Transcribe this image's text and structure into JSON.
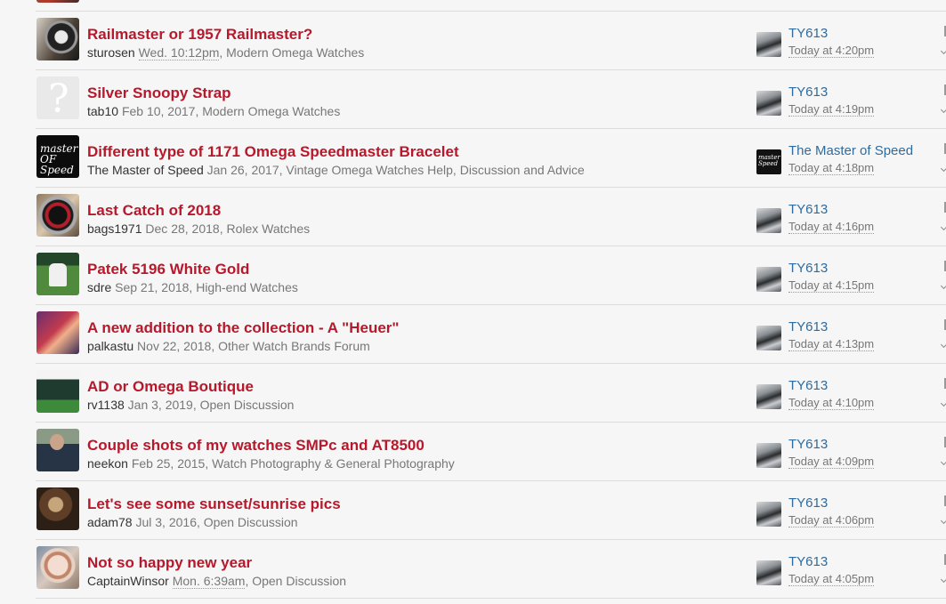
{
  "threads": [
    {
      "title": "Railmaster or 1957 Railmaster?",
      "author": "sturosen",
      "date": "Wed. 10:12pm",
      "forum": "Modern Omega Watches",
      "last_user": "TY613",
      "last_date": "Today at 4:20pm",
      "avatar": "watch-avatar"
    },
    {
      "title": "Silver Snoopy Strap",
      "author": "tab10",
      "date": "Feb 10, 2017",
      "forum": "Modern Omega Watches",
      "last_user": "TY613",
      "last_date": "Today at 4:19pm",
      "avatar": "default-avatar"
    },
    {
      "title": "Different type of 1171 Omega Speedmaster Bracelet",
      "author": "The Master of Speed",
      "date": "Jan 26, 2017",
      "forum": "Vintage Omega Watches Help, Discussion and Advice",
      "last_user": "The Master of Speed",
      "last_date": "Today at 4:18pm",
      "avatar": "master-of-speed-logo"
    },
    {
      "title": "Last Catch of 2018",
      "author": "bags1971",
      "date": "Dec 28, 2018",
      "forum": "Rolex Watches",
      "last_user": "TY613",
      "last_date": "Today at 4:16pm",
      "avatar": "rolex-avatar"
    },
    {
      "title": "Patek 5196 White Gold",
      "author": "sdre",
      "date": "Sep 21, 2018",
      "forum": "High-end Watches",
      "last_user": "TY613",
      "last_date": "Today at 4:15pm",
      "avatar": "rugby-avatar"
    },
    {
      "title": "A new addition to the collection - A \"Heuer\"",
      "author": "palkastu",
      "date": "Nov 22, 2018",
      "forum": "Other Watch Brands Forum",
      "last_user": "TY613",
      "last_date": "Today at 4:13pm",
      "avatar": "portrait-avatar"
    },
    {
      "title": "AD or Omega Boutique",
      "author": "rv1138",
      "date": "Jan 3, 2019",
      "forum": "Open Discussion",
      "last_user": "TY613",
      "last_date": "Today at 4:10pm",
      "avatar": "golf-avatar"
    },
    {
      "title": "Couple shots of my watches SMPc and AT8500",
      "author": "neekon",
      "date": "Feb 25, 2015",
      "forum": "Watch Photography & General Photography",
      "last_user": "TY613",
      "last_date": "Today at 4:09pm",
      "avatar": "man-avatar"
    },
    {
      "title": "Let's see some sunset/sunrise pics",
      "author": "adam78",
      "date": "Jul 3, 2016",
      "forum": "Open Discussion",
      "last_user": "TY613",
      "last_date": "Today at 4:06pm",
      "avatar": "bird-avatar"
    },
    {
      "title": "Not so happy new year",
      "author": "CaptainWinsor",
      "date": "Mon. 6:39am",
      "forum": "Open Discussion",
      "last_user": "TY613",
      "last_date": "Today at 4:05pm",
      "avatar": "watch-dial-avatar"
    }
  ]
}
